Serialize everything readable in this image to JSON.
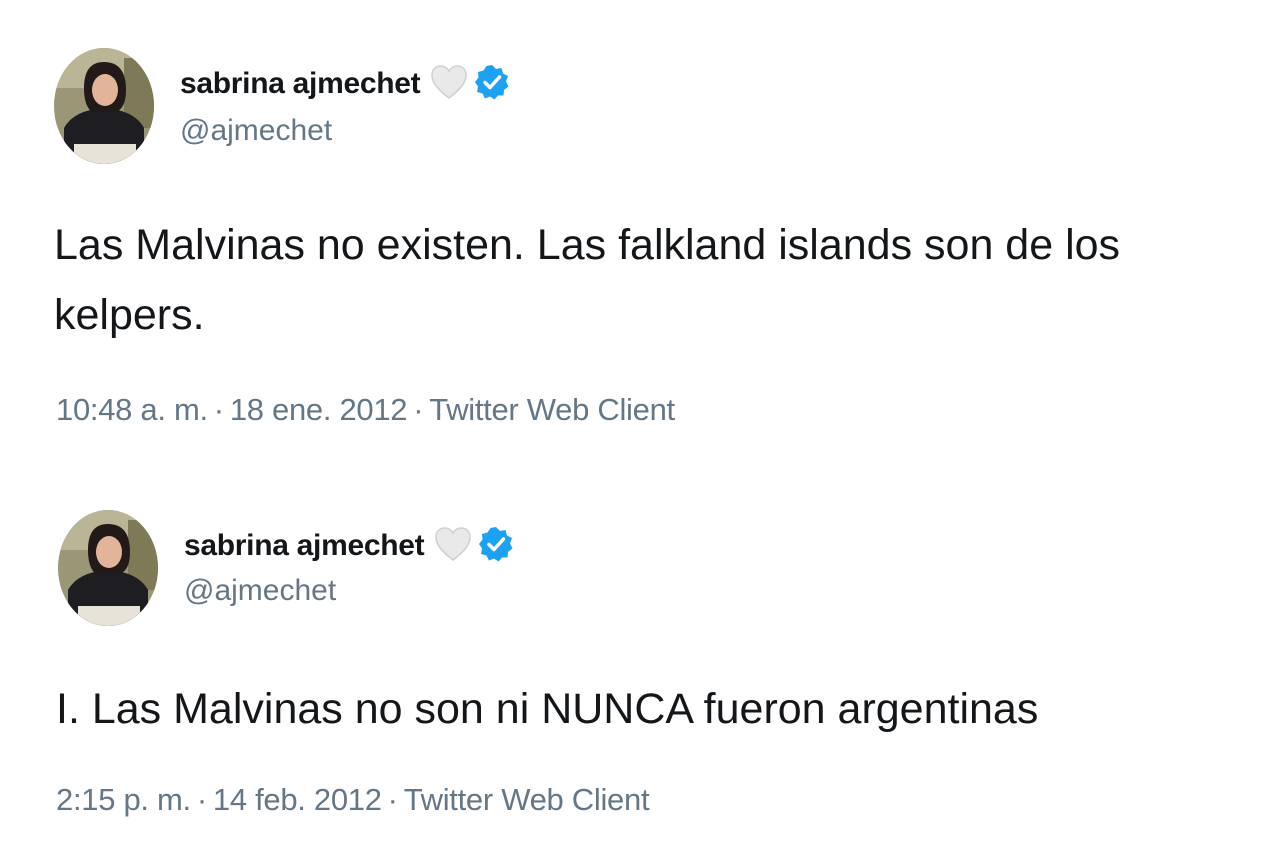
{
  "tweets": [
    {
      "display_name": "sabrina ajmechet",
      "handle": "@ajmechet",
      "text": "Las Malvinas no existen. Las falkland islands son de los kelpers.",
      "time": "10:48 a. m.",
      "date": "18 ene. 2012",
      "client": "Twitter Web Client",
      "icons": [
        "white-heart-icon",
        "verified-badge-icon"
      ]
    },
    {
      "display_name": "sabrina ajmechet",
      "handle": "@ajmechet",
      "text": "I. Las Malvinas no son ni NUNCA fueron argentinas",
      "time": "2:15 p. m.",
      "date": "14 feb. 2012",
      "client": "Twitter Web Client",
      "icons": [
        "white-heart-icon",
        "verified-badge-icon"
      ]
    }
  ],
  "separator": "·",
  "colors": {
    "text": "#14171a",
    "secondary": "#657786",
    "verified": "#1da1f2",
    "background": "#ffffff"
  }
}
